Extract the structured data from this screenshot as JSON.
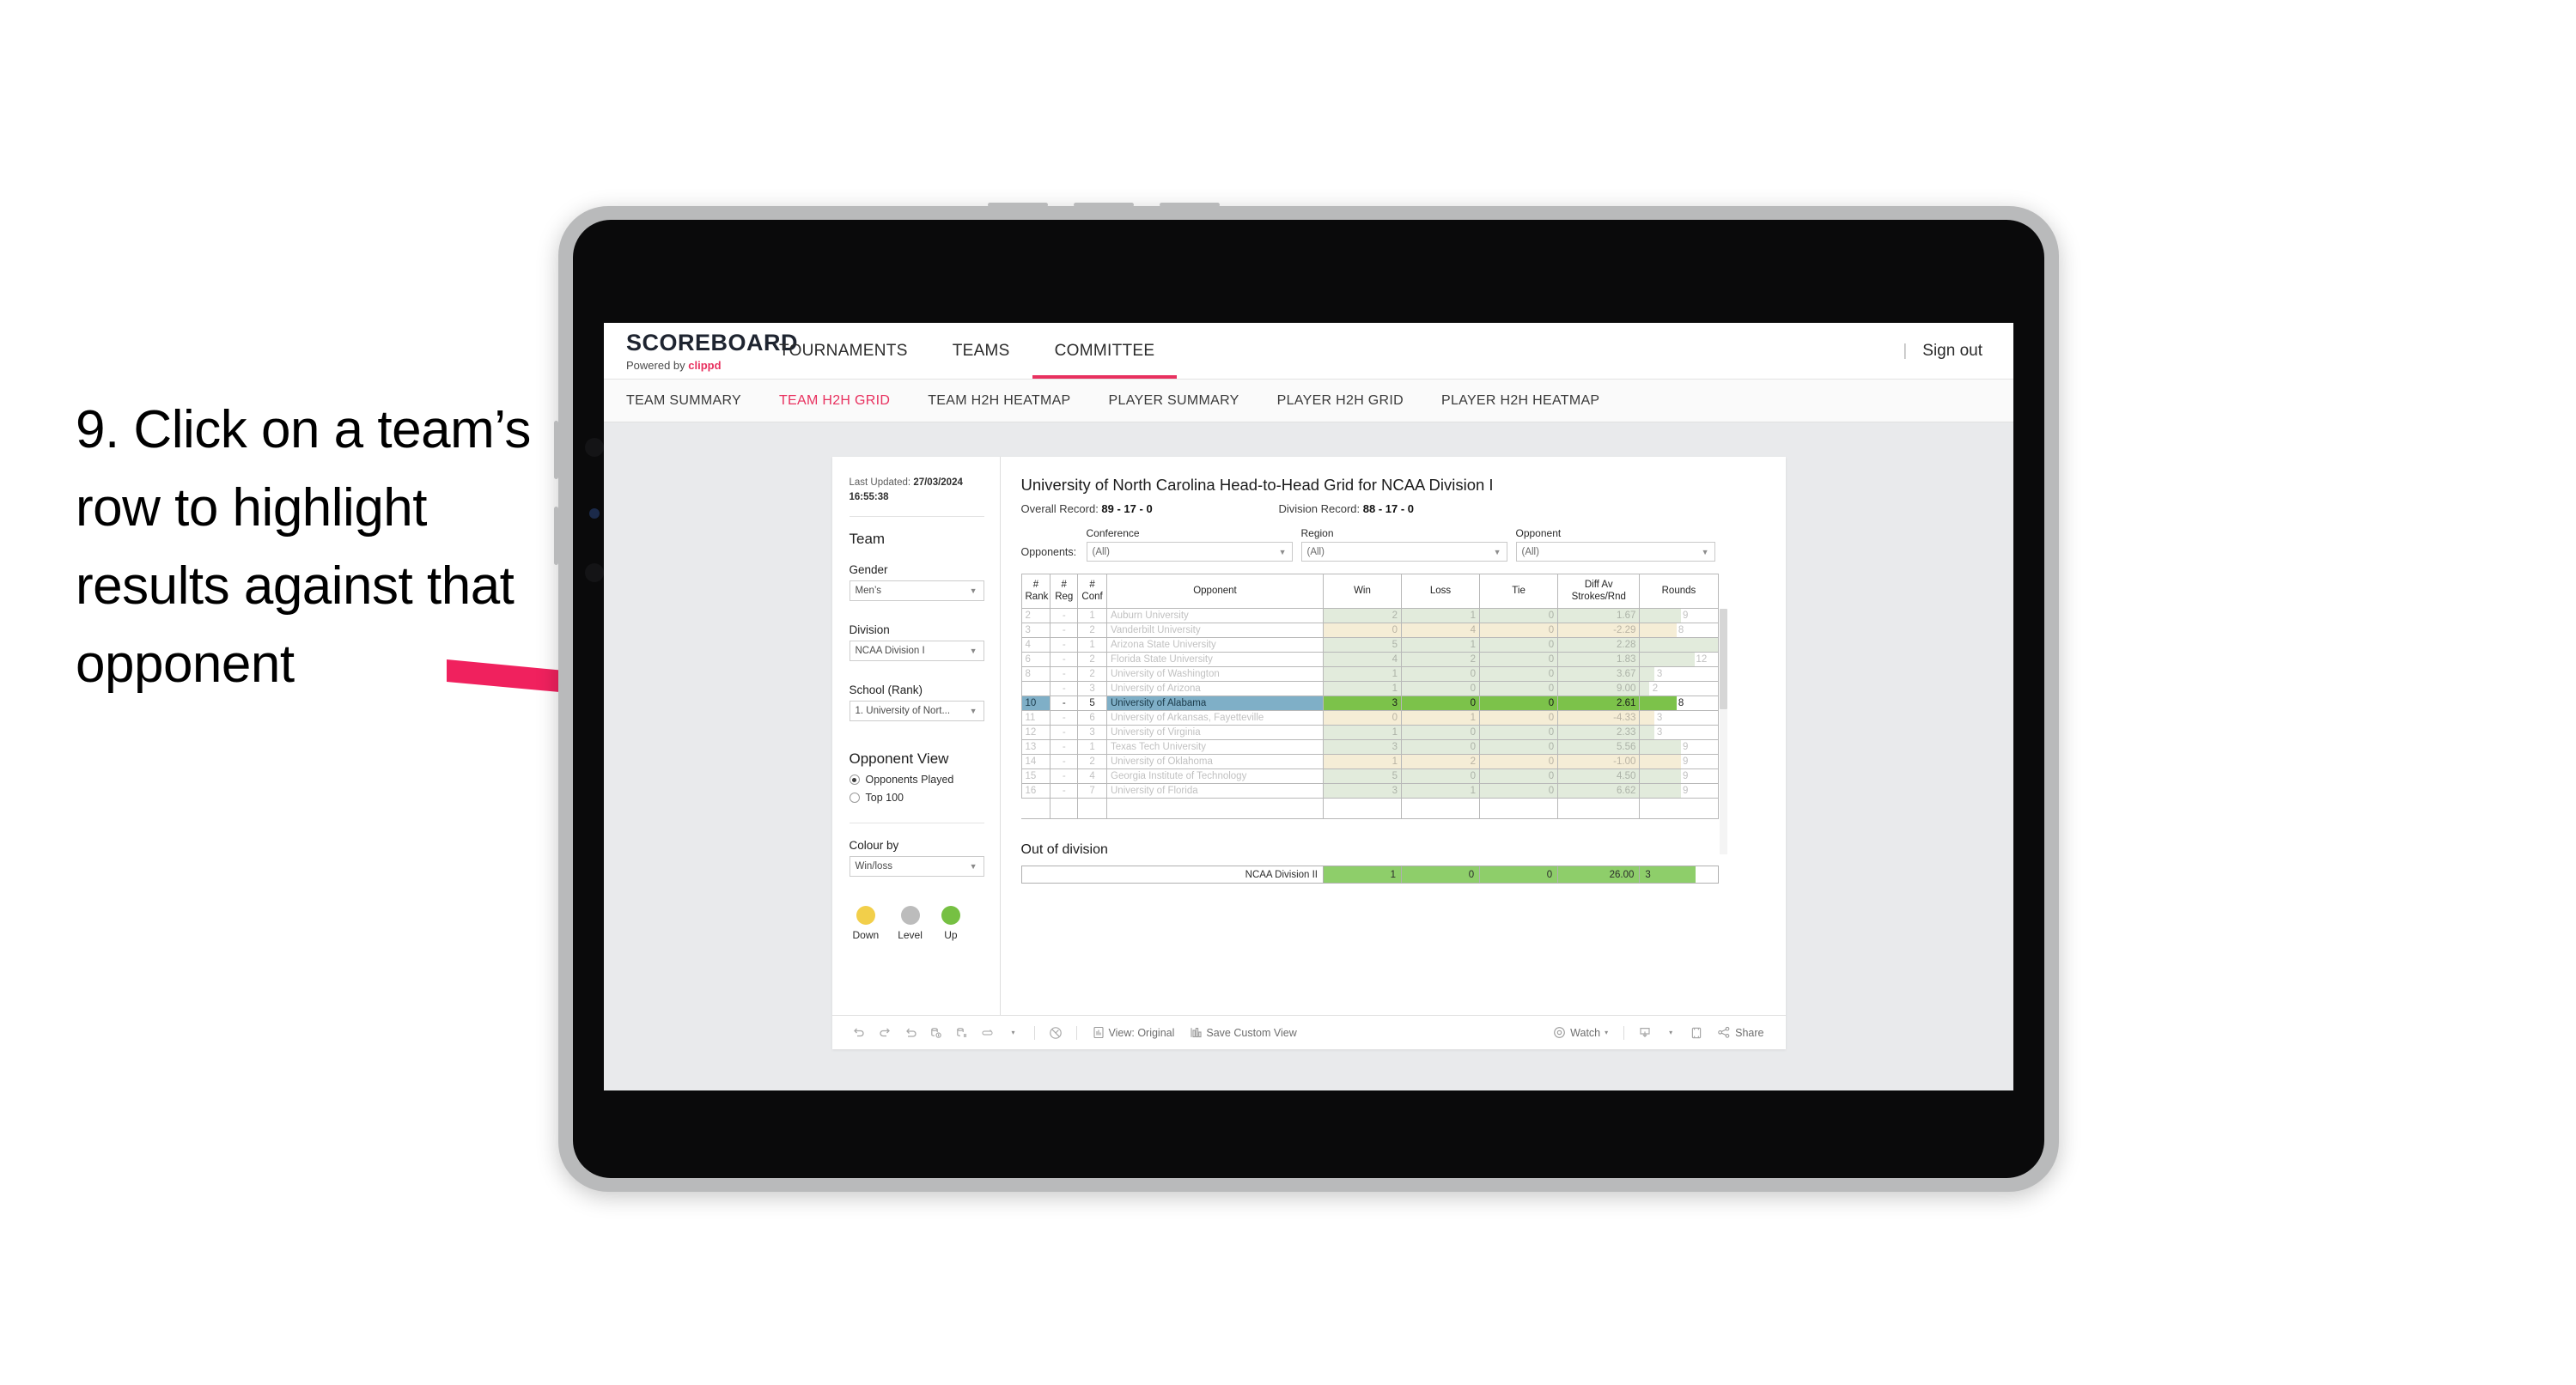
{
  "instruction": {
    "text": "9. Click on a team’s row to highlight results against that opponent"
  },
  "colors": {
    "accent_pink": "#e8315f",
    "arrow_pink": "#f0215e",
    "highlight_blue": "#7fafc7",
    "bar_green": "#6fbf44",
    "legend_down": "#f2cf4a",
    "legend_level": "#bcbcbc",
    "legend_up": "#76c043"
  },
  "topnav": {
    "brand_title": "SCOREBOARD",
    "brand_sub_prefix": "Powered by ",
    "brand_sub_name": "clippd",
    "items": [
      {
        "label": "TOURNAMENTS",
        "active": false
      },
      {
        "label": "TEAMS",
        "active": false
      },
      {
        "label": "COMMITTEE",
        "active": true
      }
    ],
    "divider": "|",
    "signout_label": "Sign out"
  },
  "subnav": {
    "items": [
      {
        "label": "TEAM SUMMARY",
        "active": false
      },
      {
        "label": "TEAM H2H GRID",
        "active": true
      },
      {
        "label": "TEAM H2H HEATMAP",
        "active": false
      },
      {
        "label": "PLAYER SUMMARY",
        "active": false
      },
      {
        "label": "PLAYER H2H GRID",
        "active": false
      },
      {
        "label": "PLAYER H2H HEATMAP",
        "active": false
      }
    ]
  },
  "sidebar": {
    "last_updated_label": "Last Updated: ",
    "last_updated_value": "27/03/2024 16:55:38",
    "team_heading": "Team",
    "gender_label": "Gender",
    "gender_value": "Men’s",
    "division_label": "Division",
    "division_value": "NCAA Division I",
    "school_label": "School (Rank)",
    "school_value": "1. University of Nort...",
    "opponent_view_heading": "Opponent View",
    "opponent_view_options": [
      {
        "label": "Opponents Played",
        "selected": true
      },
      {
        "label": "Top 100",
        "selected": false
      }
    ],
    "colour_by_label": "Colour by",
    "colour_by_value": "Win/loss",
    "legend": [
      {
        "label": "Down",
        "color": "#f2cf4a"
      },
      {
        "label": "Level",
        "color": "#bcbcbc"
      },
      {
        "label": "Up",
        "color": "#76c043"
      }
    ]
  },
  "main": {
    "title": "University of North Carolina Head-to-Head Grid for NCAA Division I",
    "overall_record_label": "Overall Record: ",
    "overall_record_value": "89 - 17 - 0",
    "division_record_label": "Division Record: ",
    "division_record_value": "88 - 17 - 0",
    "opponents_label": "Opponents:",
    "filters": [
      {
        "label": "Conference",
        "value": "(All)"
      },
      {
        "label": "Region",
        "value": "(All)"
      },
      {
        "label": "Opponent",
        "value": "(All)"
      }
    ],
    "out_of_division_title": "Out of division"
  },
  "chart_data": {
    "type": "table",
    "title": "University of North Carolina Head-to-Head Grid for NCAA Division I",
    "columns": [
      "# Rank",
      "# Reg",
      "# Conf",
      "Opponent",
      "Win",
      "Loss",
      "Tie",
      "Diff Av Strokes/Rnd",
      "Rounds"
    ],
    "column_headers_multiline": [
      [
        "#",
        "Rank"
      ],
      [
        "#",
        "Reg"
      ],
      [
        "#",
        "Conf"
      ],
      [
        "Opponent"
      ],
      [
        "Win"
      ],
      [
        "Loss"
      ],
      [
        "Tie"
      ],
      [
        "Diff Av",
        "Strokes/Rnd"
      ],
      [
        "Rounds"
      ]
    ],
    "rounds_max": 17,
    "rows": [
      {
        "rank": "2",
        "reg": "-",
        "conf": "1",
        "opponent": "Auburn University",
        "win": "2",
        "loss": "1",
        "tie": "0",
        "diff": "1.67",
        "rounds": "9",
        "state": "up",
        "highlight": false
      },
      {
        "rank": "3",
        "reg": "-",
        "conf": "2",
        "opponent": "Vanderbilt University",
        "win": "0",
        "loss": "4",
        "tie": "0",
        "diff": "-2.29",
        "rounds": "8",
        "state": "down",
        "highlight": false
      },
      {
        "rank": "4",
        "reg": "-",
        "conf": "1",
        "opponent": "Arizona State University",
        "win": "5",
        "loss": "1",
        "tie": "0",
        "diff": "2.28",
        "rounds": "17",
        "state": "up",
        "highlight": false
      },
      {
        "rank": "6",
        "reg": "-",
        "conf": "2",
        "opponent": "Florida State University",
        "win": "4",
        "loss": "2",
        "tie": "0",
        "diff": "1.83",
        "rounds": "12",
        "state": "up",
        "highlight": false
      },
      {
        "rank": "8",
        "reg": "-",
        "conf": "2",
        "opponent": "University of Washington",
        "win": "1",
        "loss": "0",
        "tie": "0",
        "diff": "3.67",
        "rounds": "3",
        "state": "up",
        "highlight": false
      },
      {
        "rank": "",
        "reg": "-",
        "conf": "3",
        "opponent": "University of Arizona",
        "win": "1",
        "loss": "0",
        "tie": "0",
        "diff": "9.00",
        "rounds": "2",
        "state": "up",
        "highlight": false
      },
      {
        "rank": "10",
        "reg": "-",
        "conf": "5",
        "opponent": "University of Alabama",
        "win": "3",
        "loss": "0",
        "tie": "0",
        "diff": "2.61",
        "rounds": "8",
        "state": "up",
        "highlight": true
      },
      {
        "rank": "11",
        "reg": "-",
        "conf": "6",
        "opponent": "University of Arkansas, Fayetteville",
        "win": "0",
        "loss": "1",
        "tie": "0",
        "diff": "-4.33",
        "rounds": "3",
        "state": "down",
        "highlight": false
      },
      {
        "rank": "12",
        "reg": "-",
        "conf": "3",
        "opponent": "University of Virginia",
        "win": "1",
        "loss": "0",
        "tie": "0",
        "diff": "2.33",
        "rounds": "3",
        "state": "up",
        "highlight": false
      },
      {
        "rank": "13",
        "reg": "-",
        "conf": "1",
        "opponent": "Texas Tech University",
        "win": "3",
        "loss": "0",
        "tie": "0",
        "diff": "5.56",
        "rounds": "9",
        "state": "up",
        "highlight": false
      },
      {
        "rank": "14",
        "reg": "-",
        "conf": "2",
        "opponent": "University of Oklahoma",
        "win": "1",
        "loss": "2",
        "tie": "0",
        "diff": "-1.00",
        "rounds": "9",
        "state": "down",
        "highlight": false
      },
      {
        "rank": "15",
        "reg": "-",
        "conf": "4",
        "opponent": "Georgia Institute of Technology",
        "win": "5",
        "loss": "0",
        "tie": "0",
        "diff": "4.50",
        "rounds": "9",
        "state": "up",
        "highlight": false
      },
      {
        "rank": "16",
        "reg": "-",
        "conf": "7",
        "opponent": "University of Florida",
        "win": "3",
        "loss": "1",
        "tie": "0",
        "diff": "6.62",
        "rounds": "9",
        "state": "up",
        "highlight": false
      }
    ],
    "out_of_division": {
      "label": "NCAA Division II",
      "win": "1",
      "loss": "0",
      "tie": "0",
      "diff": "26.00",
      "rounds": "3"
    }
  },
  "toolbar": {
    "view_label": "View: Original",
    "save_label": "Save Custom View",
    "watch_label": "Watch",
    "share_label": "Share",
    "caret": "▾"
  }
}
